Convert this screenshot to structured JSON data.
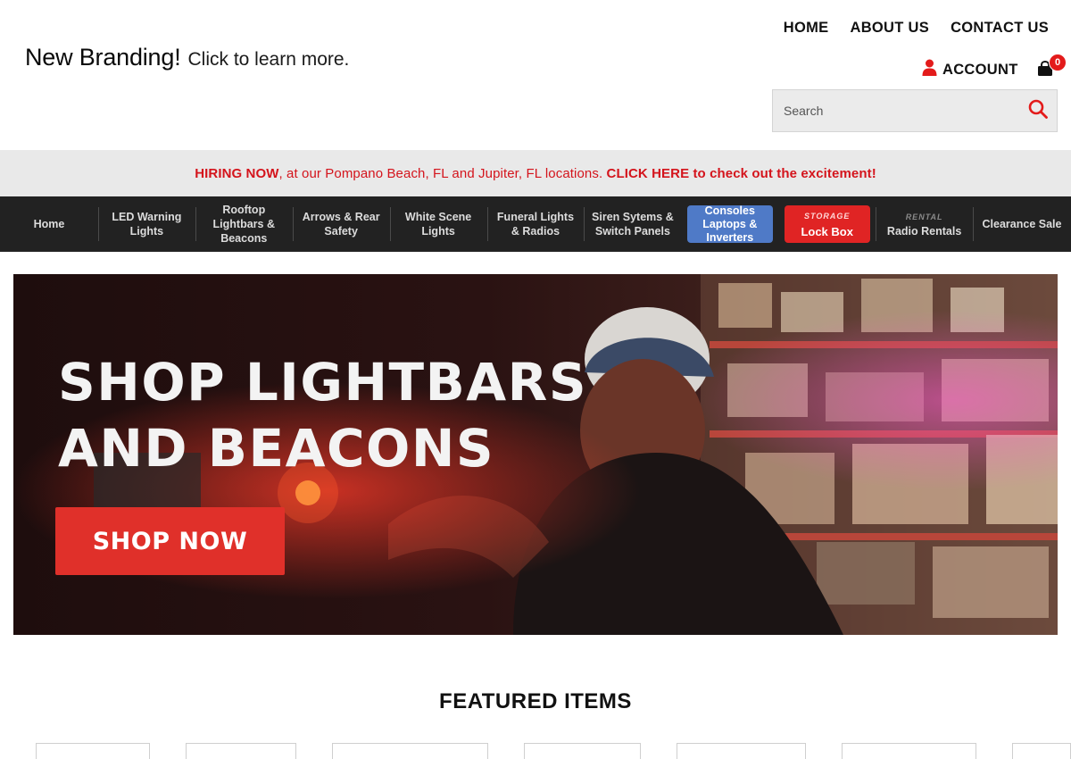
{
  "header": {
    "brand_strong": "New Branding!",
    "brand_light": "Click to learn more.",
    "top_links": [
      "HOME",
      "ABOUT US",
      "CONTACT US"
    ],
    "account_label": "ACCOUNT",
    "cart_count": "0",
    "search_placeholder": "Search"
  },
  "announcement": {
    "lead": "HIRING NOW",
    "middle": ", at our Pompano Beach, FL and Jupiter, FL locations. ",
    "cta": "CLICK HERE to check out the excitement!"
  },
  "nav": {
    "items": [
      "Home",
      "LED Warning Lights",
      "Rooftop Lightbars & Beacons",
      "Arrows & Rear Safety",
      "White Scene Lights",
      "Funeral Lights & Radios",
      "Siren Sytems & Switch Panels"
    ],
    "consoles": [
      "Consoles",
      "Laptops &",
      "Inverters"
    ],
    "storage_small": "STORAGE",
    "storage_big": "Lock Box",
    "rental_small": "RENTAL",
    "rental_big": "Radio Rentals",
    "clearance": "Clearance Sale"
  },
  "hero": {
    "line1": "SHOP LIGHTBARS",
    "line2": "AND BEACONS",
    "button": "SHOP NOW"
  },
  "featured": {
    "title": "FEATURED ITEMS"
  },
  "colors": {
    "accent_red": "#e0302a",
    "nav_bg": "#222222",
    "pill_blue": "#4f7ac7",
    "announce_bg": "#e9e9e9"
  }
}
